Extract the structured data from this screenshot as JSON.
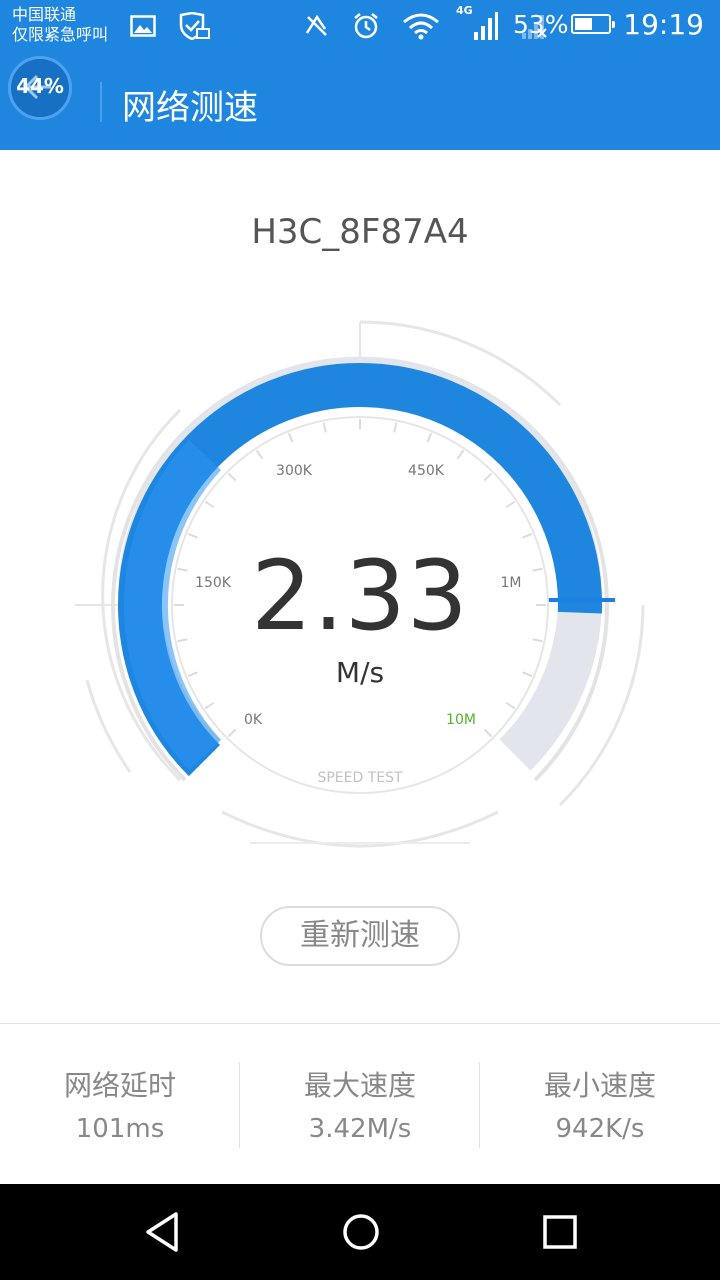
{
  "status_bar": {
    "carrier_line1": "中国联通",
    "carrier_line2": "仅限紧急呼叫",
    "network_type": "4G",
    "battery_percent": "53%",
    "battery_level": 0.53,
    "time": "19:19"
  },
  "app_bar": {
    "badge_percent": "44%",
    "title": "网络测速"
  },
  "network_name": "H3C_8F87A4",
  "gauge": {
    "speed": "2.33",
    "unit": "M/s",
    "scale_labels": [
      "0K",
      "150K",
      "300K",
      "450K",
      "1M",
      "10M"
    ],
    "caption": "SPEED TEST",
    "accent": "#1f86e0",
    "highlight_label_color": "#52b52b"
  },
  "retest_button": "重新测速",
  "stats": {
    "latency_label": "网络延时",
    "latency_value": "101ms",
    "max_label": "最大速度",
    "max_value": "3.42M/s",
    "min_label": "最小速度",
    "min_value": "942K/s"
  },
  "nav": {
    "back_icon": "triangle-back-icon",
    "home_icon": "circle-home-icon",
    "recents_icon": "square-recents-icon"
  }
}
